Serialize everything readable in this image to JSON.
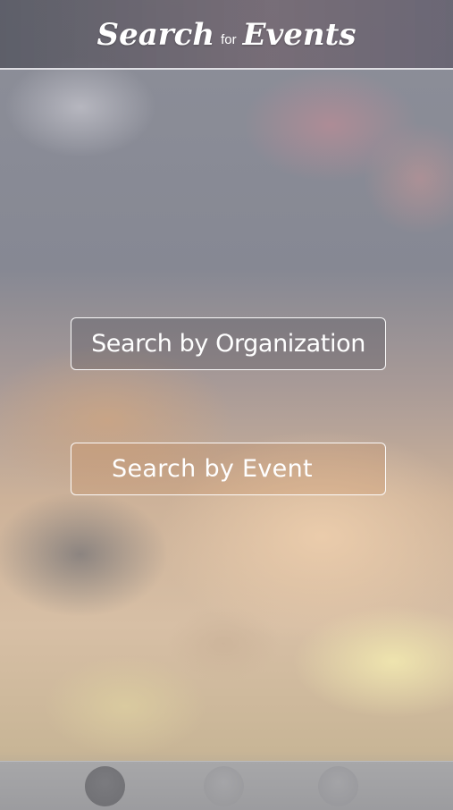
{
  "header": {
    "title_part1": "Search",
    "title_part2": "for",
    "title_part3": "Events"
  },
  "main": {
    "buttons": [
      {
        "label": "Search by Organization"
      },
      {
        "label": "Search by Event"
      }
    ]
  },
  "page_indicator": {
    "dots": 3,
    "active_index": 0
  },
  "colors": {
    "header_border": "#ebebf0",
    "button_border": "#ffffff",
    "footer_bg": "#a3a3a5",
    "active_dot": "#747478",
    "inactive_dot": "#9e9ea1"
  }
}
